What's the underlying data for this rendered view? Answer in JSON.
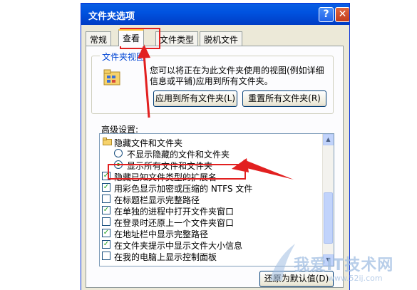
{
  "dialog": {
    "title": "文件夹选项",
    "help_glyph": "?",
    "close_glyph": "✕"
  },
  "tabs": [
    {
      "label": "常规",
      "active": false
    },
    {
      "label": "查看",
      "active": true
    },
    {
      "label": "文件类型",
      "active": false
    },
    {
      "label": "脱机文件",
      "active": false
    }
  ],
  "folder_views": {
    "legend": "文件夹视图",
    "description": "您可以将正在为此文件夹使用的视图(例如详细信息或平铺)应用到所有文件夹。",
    "apply_button": "应用到所有文件夹(L)",
    "reset_button": "重置所有文件夹(R)"
  },
  "advanced": {
    "label": "高级设置:",
    "items": [
      {
        "type": "folder",
        "label": "隐藏文件和文件夹"
      },
      {
        "type": "radio",
        "label": "不显示隐藏的文件和文件夹",
        "checked": false
      },
      {
        "type": "radio",
        "label": "显示所有文件和文件夹",
        "checked": true
      },
      {
        "type": "checkbox",
        "label": "隐藏已知文件类型的扩展名",
        "checked": true
      },
      {
        "type": "checkbox",
        "label": "用彩色显示加密或压缩的 NTFS 文件",
        "checked": true
      },
      {
        "type": "checkbox",
        "label": "在标题栏显示完整路径",
        "checked": false
      },
      {
        "type": "checkbox",
        "label": "在单独的进程中打开文件夹窗口",
        "checked": true
      },
      {
        "type": "checkbox",
        "label": "在登录时还原上一个文件夹窗口",
        "checked": false
      },
      {
        "type": "checkbox",
        "label": "在地址栏中显示完整路径",
        "checked": true
      },
      {
        "type": "checkbox",
        "label": "在文件夹提示中显示文件大小信息",
        "checked": true
      },
      {
        "type": "checkbox",
        "label": "在我的电脑上显示控制面板",
        "checked": false
      }
    ],
    "check_glyph": "✓"
  },
  "restore_button": "还原为默认值(D)",
  "watermark": {
    "line1": "我爱IT技术网",
    "line2": "www.52ij.com"
  },
  "colors": {
    "titlebar": "#0053e0",
    "annotation": "#e22020",
    "check": "#21a121"
  }
}
